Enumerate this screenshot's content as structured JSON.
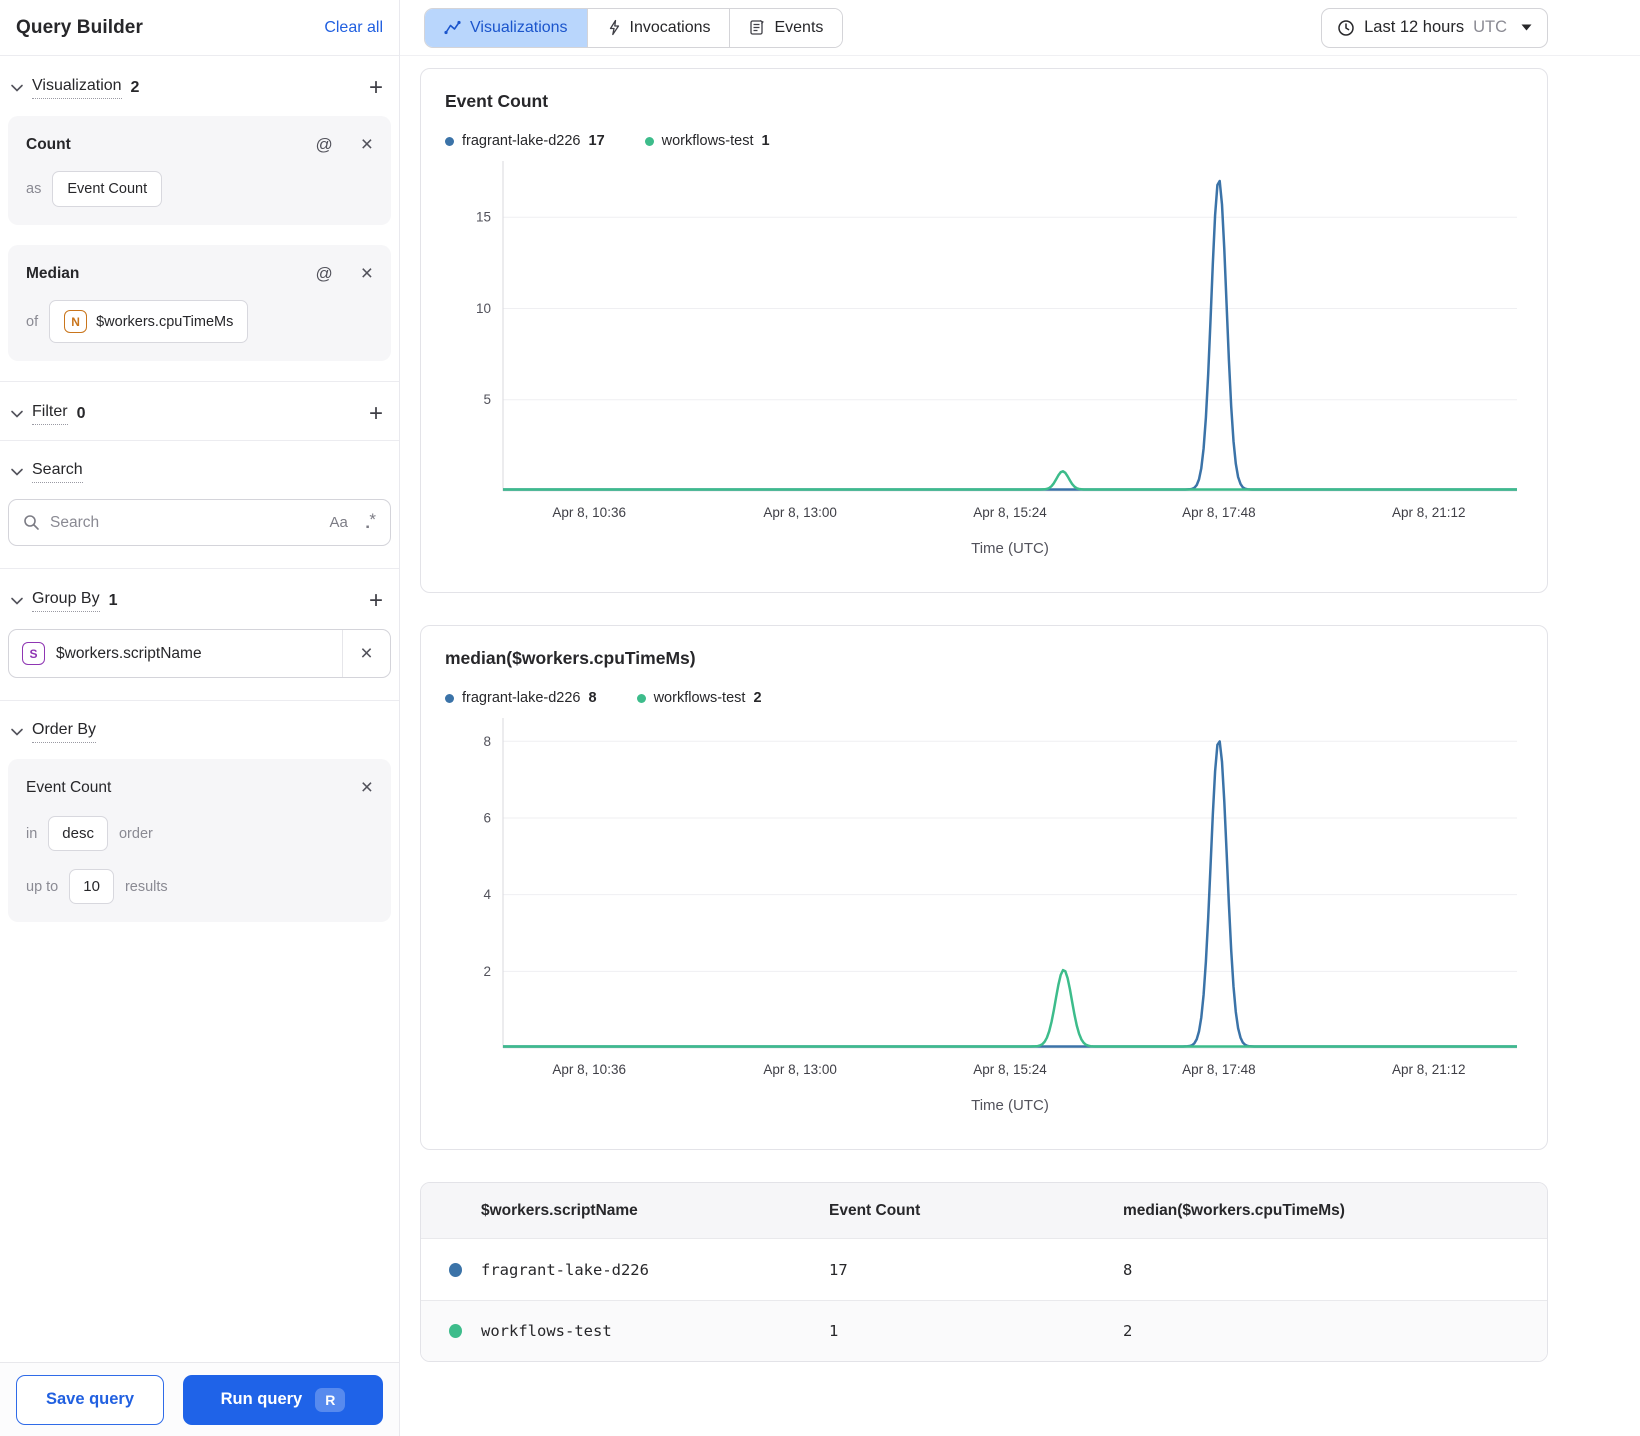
{
  "sidebar": {
    "title": "Query Builder",
    "clear_all_label": "Clear all",
    "sections": {
      "visualization": {
        "label": "Visualization",
        "count": 2
      },
      "filter": {
        "label": "Filter",
        "count": 0
      },
      "search": {
        "label": "Search"
      },
      "group_by": {
        "label": "Group By",
        "count": 1
      },
      "order_by": {
        "label": "Order By"
      }
    },
    "visualization_cards": [
      {
        "title": "Count",
        "prefix": "as",
        "value": "Event Count"
      },
      {
        "title": "Median",
        "prefix": "of",
        "field_badge": "N",
        "value": "$workers.cpuTimeMs"
      }
    ],
    "search_input": {
      "placeholder": "Search",
      "match_case_label": "Aa",
      "regex_label": ".*"
    },
    "group_by_items": [
      {
        "badge": "S",
        "value": "$workers.scriptName"
      }
    ],
    "order_by_card": {
      "field": "Event Count",
      "in_label": "in",
      "direction": "desc",
      "order_label": "order",
      "up_to_label": "up to",
      "limit": 10,
      "results_label": "results"
    },
    "footer": {
      "save_label": "Save query",
      "run_label": "Run query",
      "run_shortcut": "R"
    }
  },
  "topbar": {
    "tabs": [
      {
        "label": "Visualizations",
        "active": true
      },
      {
        "label": "Invocations",
        "active": false
      },
      {
        "label": "Events",
        "active": false
      }
    ],
    "time_range": {
      "label": "Last 12 hours",
      "timezone": "UTC"
    }
  },
  "colors": {
    "accent_blue": "#1f63e8",
    "tab_active_bg": "#b9d6fc",
    "series_blue": "#3b73a8",
    "series_green": "#3dbc8b"
  },
  "chart_data": [
    {
      "type": "line",
      "title": "Event Count",
      "xlabel": "Time (UTC)",
      "x_ticks": [
        "Apr 8, 10:36",
        "Apr 8, 13:00",
        "Apr 8, 15:24",
        "Apr 8, 17:48",
        "Apr 8, 21:12"
      ],
      "x_tick_fractions": [
        0.085,
        0.293,
        0.5,
        0.706,
        0.913
      ],
      "y_ticks": [
        5,
        10,
        15
      ],
      "y_max": 17.75,
      "grid": true,
      "legend_position": "top",
      "series": [
        {
          "name": "fragrant-lake-d226",
          "color": "series_blue",
          "baseline": 0,
          "peaks": [
            {
              "center": 0.706,
              "height": 17,
              "sigma": 0.0075
            }
          ]
        },
        {
          "name": "workflows-test",
          "color": "series_green",
          "baseline": 0,
          "peaks": [
            {
              "center": 0.552,
              "height": 1,
              "sigma": 0.006
            }
          ]
        }
      ],
      "legend": [
        {
          "name": "fragrant-lake-d226",
          "total": 17
        },
        {
          "name": "workflows-test",
          "total": 1
        }
      ]
    },
    {
      "type": "line",
      "title": "median($workers.cpuTimeMs)",
      "xlabel": "Time (UTC)",
      "x_ticks": [
        "Apr 8, 10:36",
        "Apr 8, 13:00",
        "Apr 8, 15:24",
        "Apr 8, 17:48",
        "Apr 8, 21:12"
      ],
      "x_tick_fractions": [
        0.085,
        0.293,
        0.5,
        0.706,
        0.913
      ],
      "y_ticks": [
        2,
        4,
        6,
        8
      ],
      "y_max": 8.45,
      "grid": true,
      "legend_position": "top",
      "series": [
        {
          "name": "fragrant-lake-d226",
          "color": "series_blue",
          "baseline": 0,
          "peaks": [
            {
              "center": 0.706,
              "height": 8,
              "sigma": 0.008
            }
          ]
        },
        {
          "name": "workflows-test",
          "color": "series_green",
          "baseline": 0,
          "peaks": [
            {
              "center": 0.553,
              "height": 2,
              "sigma": 0.008
            }
          ]
        }
      ],
      "legend": [
        {
          "name": "fragrant-lake-d226",
          "total": 8
        },
        {
          "name": "workflows-test",
          "total": 2
        }
      ]
    }
  ],
  "table": {
    "headers": [
      "$workers.scriptName",
      "Event Count",
      "median($workers.cpuTimeMs)"
    ],
    "rows": [
      {
        "name": "fragrant-lake-d226",
        "event_count": 17,
        "median": 8
      },
      {
        "name": "workflows-test",
        "event_count": 1,
        "median": 2
      }
    ]
  }
}
